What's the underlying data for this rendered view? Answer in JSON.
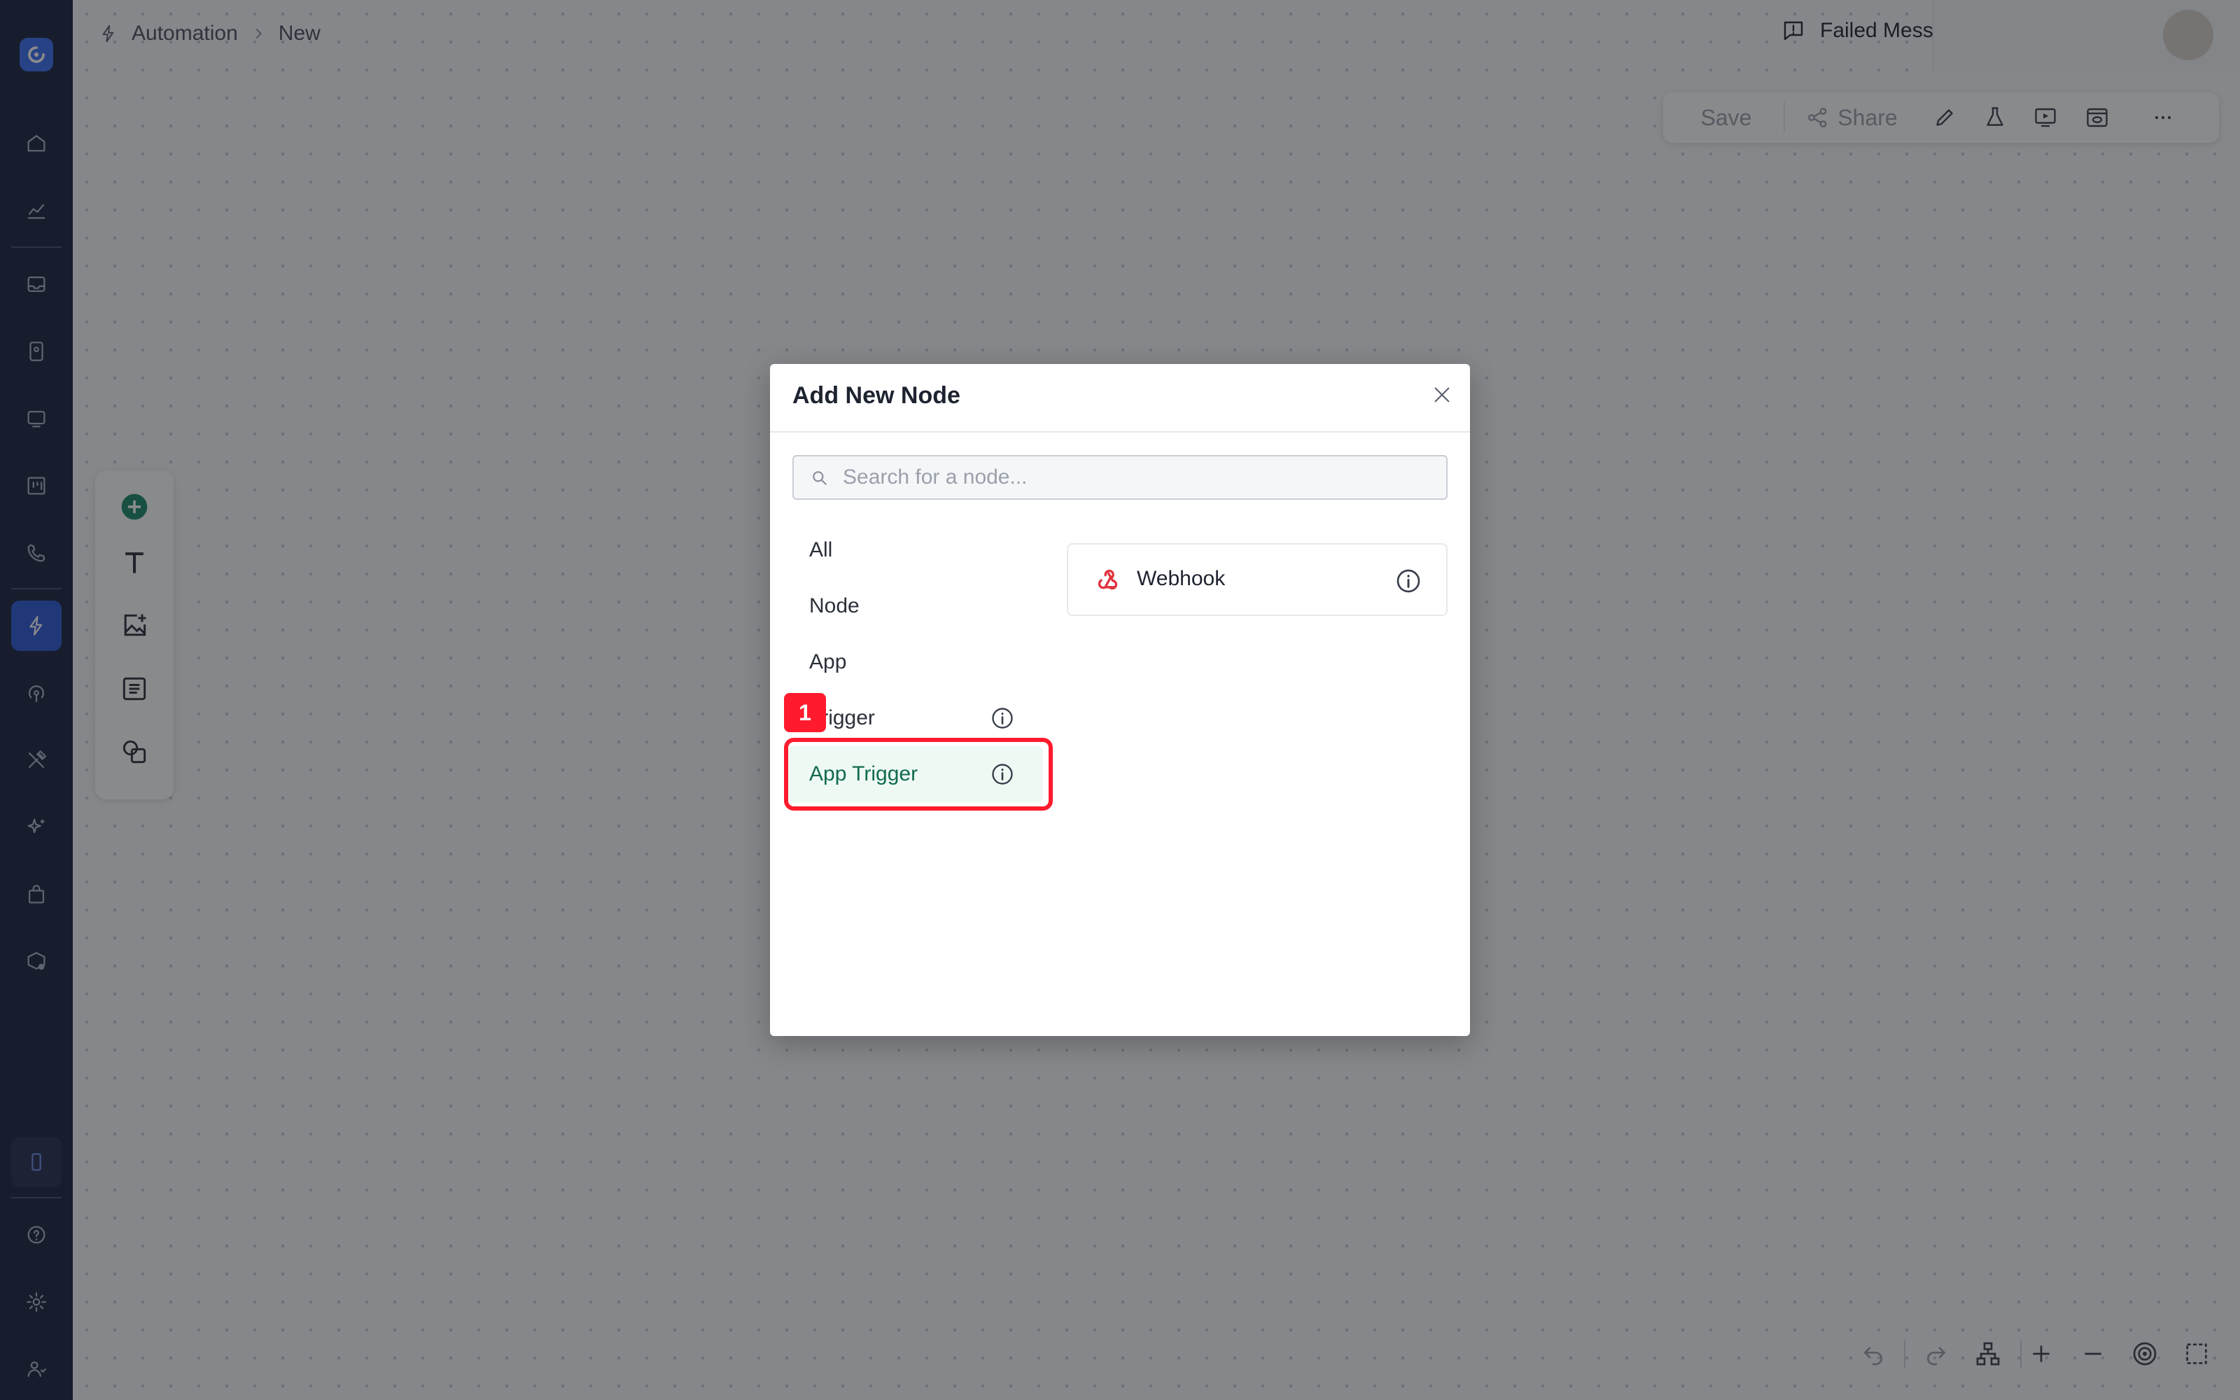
{
  "sidebar": {
    "logo_icon": "chatwoot-logo-icon",
    "items": [
      {
        "icon": "home-icon"
      },
      {
        "icon": "analytics-icon"
      },
      {
        "icon": "inbox-icon"
      },
      {
        "icon": "contacts-icon"
      },
      {
        "icon": "conversations-icon"
      },
      {
        "icon": "kanban-icon"
      },
      {
        "icon": "phone-icon"
      },
      {
        "icon": "automation-icon",
        "active": true
      },
      {
        "icon": "broadcast-icon"
      },
      {
        "icon": "tools-icon"
      },
      {
        "icon": "ai-sparkle-icon"
      },
      {
        "icon": "store-icon"
      },
      {
        "icon": "integrations-icon"
      },
      {
        "icon": "mobile-icon"
      },
      {
        "icon": "help-icon"
      },
      {
        "icon": "settings-icon"
      },
      {
        "icon": "team-icon"
      }
    ]
  },
  "header": {
    "breadcrumb": {
      "section": "Automation",
      "current": "New"
    },
    "failed_messages_label": "Failed Mess"
  },
  "toolbar": {
    "save_label": "Save",
    "share_label": "Share"
  },
  "modal": {
    "title": "Add New Node",
    "search_placeholder": "Search for a node...",
    "categories": [
      {
        "label": "All"
      },
      {
        "label": "Node"
      },
      {
        "label": "App"
      },
      {
        "label": "Trigger"
      },
      {
        "label": "App Trigger",
        "selected": true
      }
    ],
    "badge": "1",
    "nodes": [
      {
        "label": "Webhook",
        "icon": "webhook-icon"
      }
    ]
  },
  "colors": {
    "sidebar_bg": "#1b2540",
    "accent_blue": "#2f5bd6",
    "selected_bg": "#eef9f4",
    "selected_text": "#116b4d",
    "annotation_red": "#ff1b2d",
    "webhook_red": "#e0333d",
    "add_green": "#1a8a6a"
  }
}
